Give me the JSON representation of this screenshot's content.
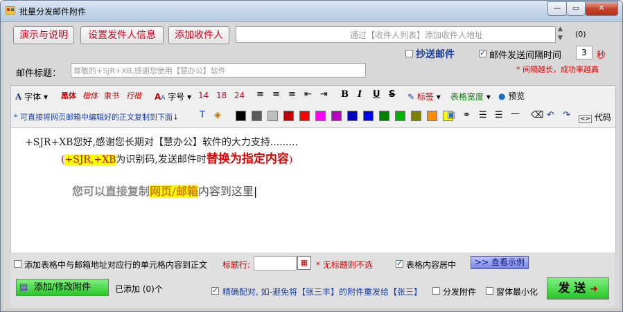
{
  "window": {
    "title": "批量分发邮件附件"
  },
  "top_buttons": {
    "demo": "演示与说明",
    "sender": "设置发件人信息",
    "add_recipient": "添加收件人"
  },
  "recipient_field": {
    "placeholder": "通过【收件人列表】添加收件人地址"
  },
  "recipient_count": "(0)",
  "cc": {
    "label": "抄送邮件",
    "checked": false
  },
  "interval": {
    "label": "邮件发送间隔时间",
    "checked": true,
    "value": "3",
    "unit": "秒",
    "note": "* 间隔越长，成功率越高"
  },
  "subject": {
    "label": "邮件标题：",
    "value": "尊敬的+SJR+XB,感谢您使用【慧办公】软件"
  },
  "toolbar": {
    "font_label": "字体",
    "fonts": [
      "黑体",
      "楷体",
      "隶书",
      "行楷"
    ],
    "size_label": "字号",
    "sizes": [
      "14",
      "18",
      "24"
    ],
    "tag_label": "标签",
    "table_width_label": "表格宽度",
    "preview_label": "预览",
    "paste_tip": "* 可直接将网页邮箱中编辑好的正文复制到下面↓",
    "code_label": "代码",
    "colors": [
      "#000000",
      "#5a5a5a",
      "#c0c0c0",
      "#c00000",
      "#ff0000",
      "#ff00ff",
      "#c000c0",
      "#0000c0",
      "#0000ff",
      "#008000",
      "#00b000",
      "#808000",
      "#ff8c00",
      "#ffff00"
    ]
  },
  "content": {
    "line1": "+SJR+XB您好,感谢您长期对【慧办公】软件的大力支持.........",
    "line2_open": "(",
    "line2_code": "+SJR,+XB",
    "line2_mid": "为识别码,发送邮件时",
    "line2_bold": "替换为指定内容",
    "line2_close": ")",
    "line3_pre": "您可以直接复制",
    "line3_hl": "网页/邮箱",
    "line3_post": "内容到这里"
  },
  "bottom": {
    "add_table_label": "添加表格中与邮箱地址对应行的单元格内容到正文",
    "header_row_label": "标题行:",
    "header_row_note": "* 无标题则不选",
    "center_label": "表格内容居中",
    "center_checked": true,
    "view_example": "查看示例",
    "add_attach": "添加/修改附件",
    "added_count": "已添加 (0)个",
    "exact_match": "精确配对, 如-避免将【张三丰】的附件重发给【张三】",
    "exact_checked": true,
    "distribute_label": "分发附件",
    "minimize_label": "窗体最小化",
    "send": "发 送"
  }
}
